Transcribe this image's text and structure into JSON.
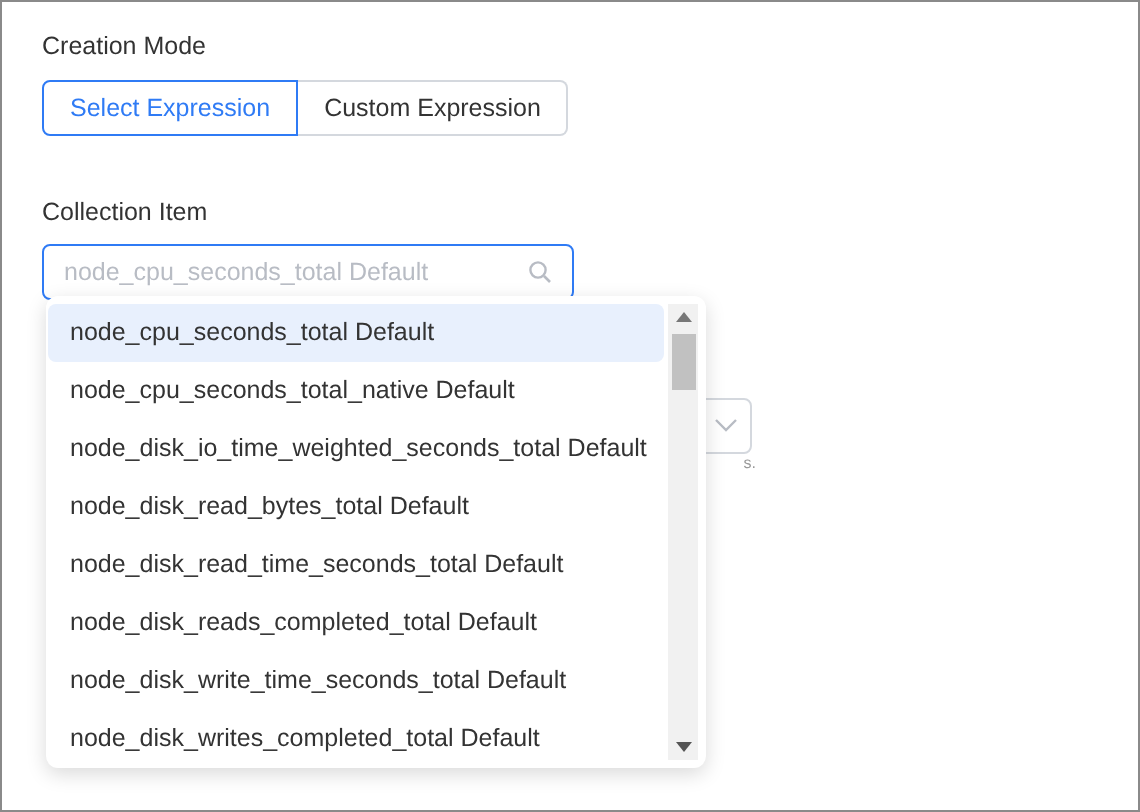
{
  "creation_mode": {
    "label": "Creation Mode",
    "options": [
      {
        "label": "Select Expression",
        "selected": true
      },
      {
        "label": "Custom Expression",
        "selected": false
      }
    ]
  },
  "collection_item": {
    "label": "Collection Item",
    "placeholder": "node_cpu_seconds_total Default",
    "focused": true
  },
  "dropdown": {
    "items": [
      {
        "label": "node_cpu_seconds_total Default",
        "selected": true
      },
      {
        "label": "node_cpu_seconds_total_native Default",
        "selected": false
      },
      {
        "label": "node_disk_io_time_weighted_seconds_total Default",
        "selected": false
      },
      {
        "label": "node_disk_read_bytes_total Default",
        "selected": false
      },
      {
        "label": "node_disk_read_time_seconds_total Default",
        "selected": false
      },
      {
        "label": "node_disk_reads_completed_total Default",
        "selected": false
      },
      {
        "label": "node_disk_write_time_seconds_total Default",
        "selected": false
      },
      {
        "label": "node_disk_writes_completed_total Default",
        "selected": false
      }
    ]
  },
  "hidden_field": {
    "hint": "s."
  }
}
